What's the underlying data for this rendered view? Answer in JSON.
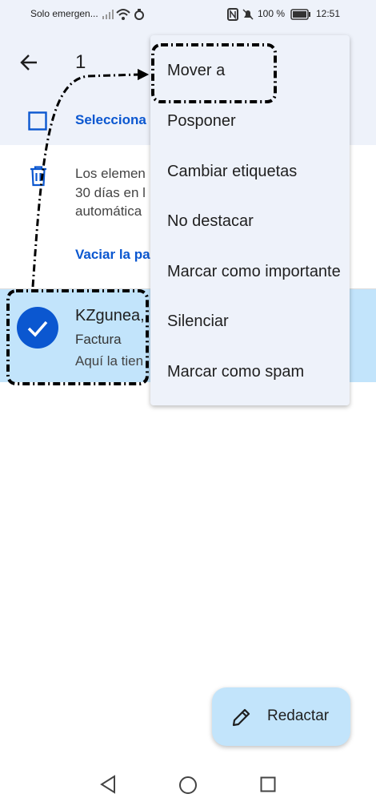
{
  "status_bar": {
    "carrier": "Solo emergen...",
    "battery": "100 %",
    "time": "12:51"
  },
  "app_bar": {
    "selected_count": "1",
    "select_all_label": "Selecciona"
  },
  "trash_notice": {
    "lines": [
      "Los elemen",
      "30 días en l",
      "automática"
    ],
    "empty_link": "Vaciar la pa"
  },
  "mail": {
    "sender": "KZgunea,",
    "subject": "Factura",
    "snippet": "Aquí la tien"
  },
  "menu": {
    "items": [
      "Mover a",
      "Posponer",
      "Cambiar etiquetas",
      "No destacar",
      "Marcar como importante",
      "Silenciar",
      "Marcar como spam"
    ]
  },
  "fab": {
    "label": "Redactar"
  },
  "colors": {
    "surface": "#eef2fa",
    "accent_blue": "#0b57d0",
    "selected_row": "#c2e4fb"
  }
}
